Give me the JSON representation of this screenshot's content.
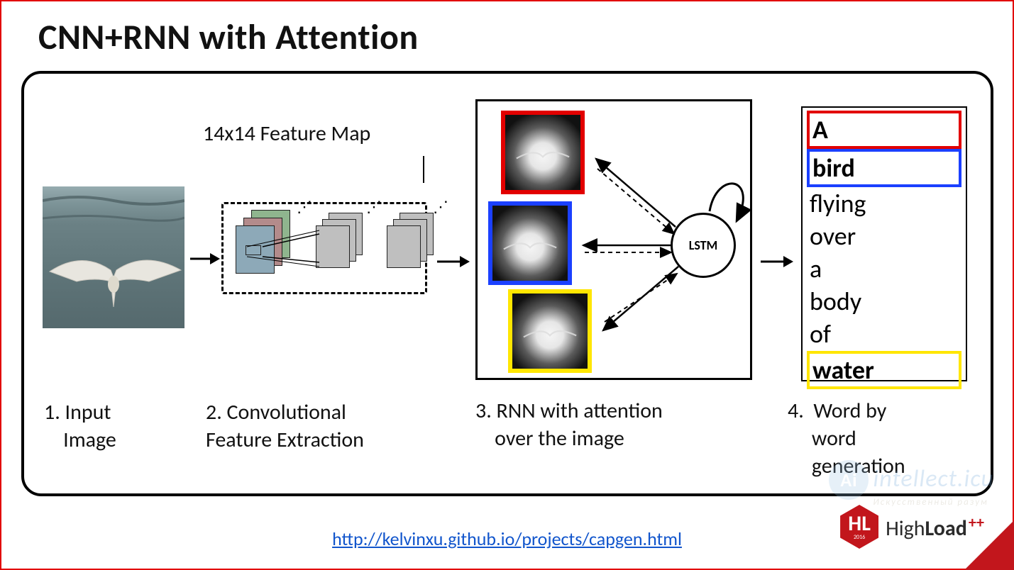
{
  "title": "CNN+RNN with Attention",
  "feature_map_label": "14x14 Feature Map",
  "lstm_label": "LSTM",
  "captions": {
    "c1": "1. Input\n    Image",
    "c2": "2. Convolutional\nFeature Extraction",
    "c3": "3. RNN with attention\n    over the image",
    "c4": "4.  Word by\n     word\n     generation"
  },
  "output_words": [
    {
      "text": "A",
      "style": "red framed"
    },
    {
      "text": "bird",
      "style": "blue framed"
    },
    {
      "text": "flying",
      "style": ""
    },
    {
      "text": "over",
      "style": ""
    },
    {
      "text": "a",
      "style": ""
    },
    {
      "text": "body",
      "style": ""
    },
    {
      "text": "of",
      "style": ""
    },
    {
      "text": "water",
      "style": "yellow framed"
    }
  ],
  "reference_url": "http://kelvinxu.github.io/projects/capgen.html",
  "logo": {
    "hex_text": "HL",
    "hex_year": "2016",
    "brand_light": "High",
    "brand_bold": "Load",
    "suffix": "++"
  },
  "watermark": {
    "badge": "Ai",
    "text": "intellect.icu",
    "sub": "Искусственный разум"
  }
}
